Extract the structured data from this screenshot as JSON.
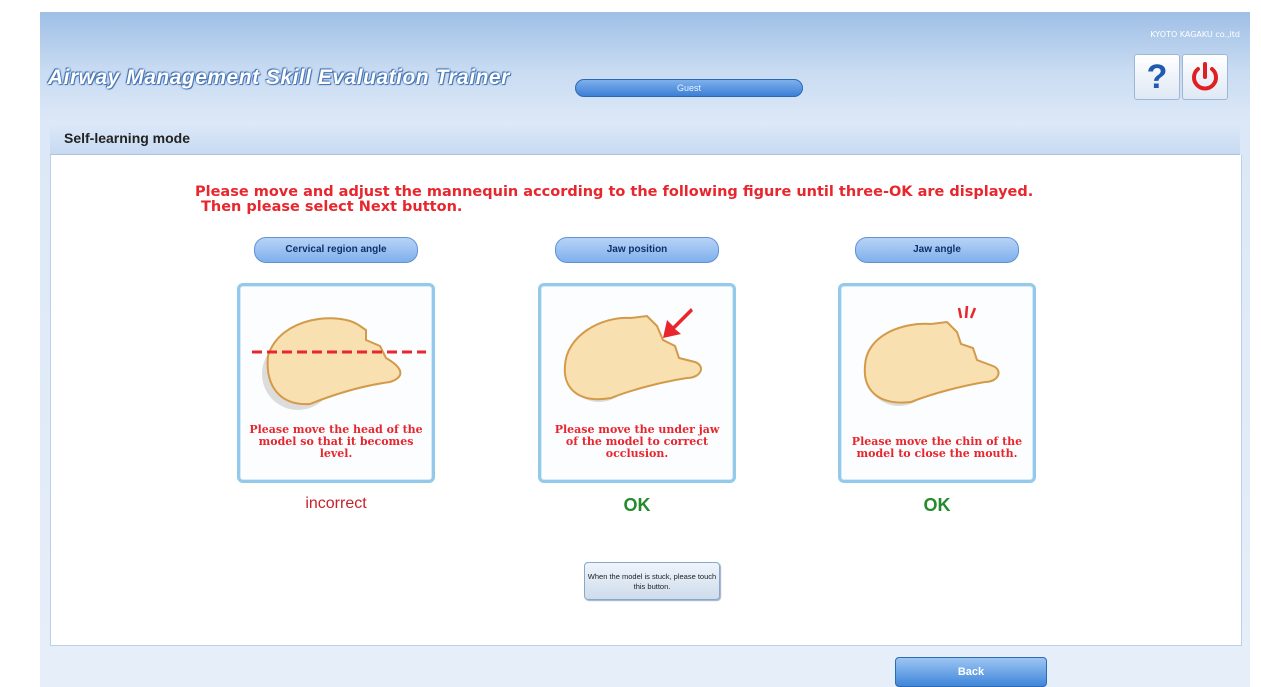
{
  "header": {
    "brand": "KYOTO KAGAKU co.,ltd",
    "app_title": "Airway Management Skill Evaluation Trainer",
    "user": "Guest",
    "help_icon": "question-mark-icon",
    "power_icon": "power-icon"
  },
  "mode": {
    "title": "Self-learning mode"
  },
  "instruction": {
    "line1": "Please move and adjust the mannequin according to the following figure until three-OK are displayed.",
    "line2": "Then please select Next button."
  },
  "checks": [
    {
      "label": "Cervical region angle",
      "card_text": "Please move the head of the model so that it becomes level.",
      "status": "incorrect"
    },
    {
      "label": "Jaw position",
      "card_text": "Please move the under jaw of the model to correct occlusion.",
      "status": "OK"
    },
    {
      "label": "Jaw angle",
      "card_text": "Please move the chin of the model to close the mouth.",
      "status": "OK"
    }
  ],
  "stuck_button": "When the model is stuck, please touch this button.",
  "back_button": "Back",
  "colors": {
    "error": "#e8262d",
    "ok": "#238b2c",
    "accent": "#3c7fd6"
  }
}
